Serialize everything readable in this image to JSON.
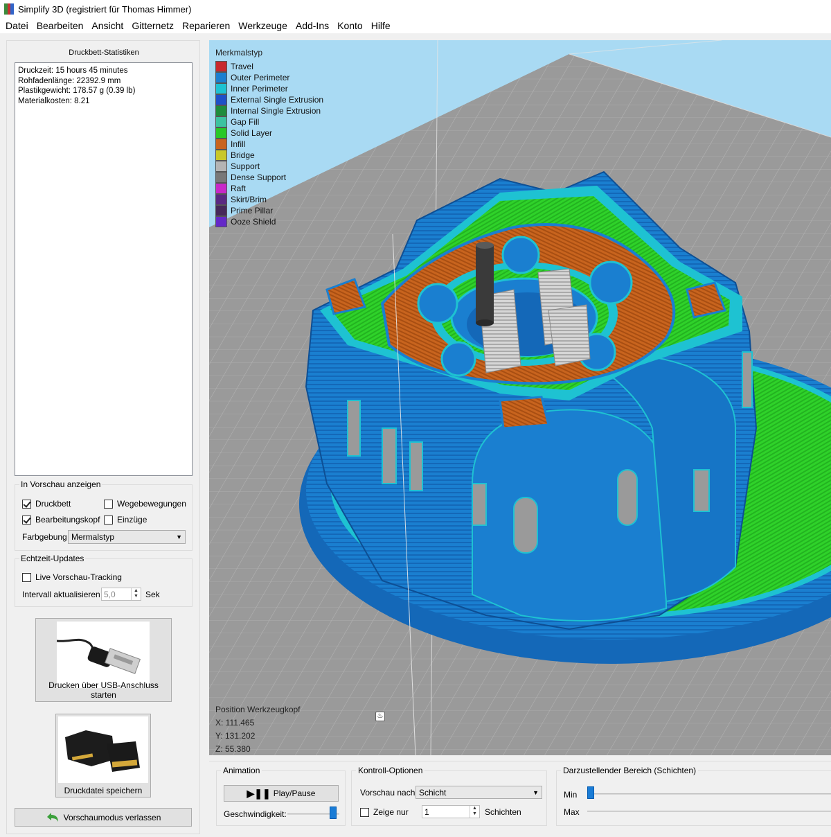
{
  "window": {
    "title": "Simplify 3D (registriert für Thomas Himmer)"
  },
  "menu": [
    "Datei",
    "Bearbeiten",
    "Ansicht",
    "Gitternetz",
    "Reparieren",
    "Werkzeuge",
    "Add-Ins",
    "Konto",
    "Hilfe"
  ],
  "stats": {
    "title": "Druckbett-Statistiken",
    "lines": [
      "Druckzeit: 15 hours 45 minutes",
      "Rohfadenlänge: 22392.9 mm",
      "Plastikgewicht: 178.57 g (0.39 lb)",
      "Materialkosten: 8.21"
    ]
  },
  "preview": {
    "title": "In Vorschau anzeigen",
    "druckbett": {
      "label": "Druckbett",
      "checked": true
    },
    "wegebewegungen": {
      "label": "Wegebewegungen",
      "checked": false
    },
    "bearbeitungskopf": {
      "label": "Bearbeitungskopf",
      "checked": true
    },
    "einzuege": {
      "label": "Einzüge",
      "checked": false
    },
    "farbgebung_label": "Farbgebung",
    "farbgebung_value": "Mermalstyp"
  },
  "realtime": {
    "title": "Echtzeit-Updates",
    "live_label": "Live Vorschau-Tracking",
    "live_checked": false,
    "interval_label": "Intervall aktualisieren",
    "interval_value": "5,0",
    "interval_unit": "Sek"
  },
  "buttons": {
    "usb_label": "Drucken über USB-Anschluss starten",
    "save_label": "Druckdatei speichern",
    "leave_label": "Vorschaumodus verlassen"
  },
  "legend": {
    "title": "Merkmalstyp",
    "items": [
      {
        "label": "Travel",
        "color": "#c8282d"
      },
      {
        "label": "Outer Perimeter",
        "color": "#1a7fd0"
      },
      {
        "label": "Inner Perimeter",
        "color": "#1ec2d2"
      },
      {
        "label": "External Single Extrusion",
        "color": "#1e50c8"
      },
      {
        "label": "Internal Single Extrusion",
        "color": "#1e8c3c"
      },
      {
        "label": "Gap Fill",
        "color": "#3cc3a0"
      },
      {
        "label": "Solid Layer",
        "color": "#28c828"
      },
      {
        "label": "Infill",
        "color": "#c8641e"
      },
      {
        "label": "Bridge",
        "color": "#c8c828"
      },
      {
        "label": "Support",
        "color": "#b4b4b4"
      },
      {
        "label": "Dense Support",
        "color": "#787878"
      },
      {
        "label": "Raft",
        "color": "#c828c8"
      },
      {
        "label": "Skirt/Brim",
        "color": "#5a2882"
      },
      {
        "label": "Prime Pillar",
        "color": "#46285a"
      },
      {
        "label": "Ooze Shield",
        "color": "#6428c8"
      }
    ]
  },
  "toolhead": {
    "title": "Position Werkzeugkopf",
    "x": "X: 111.465",
    "y": "Y: 131.202",
    "z": "Z: 55.380"
  },
  "animation": {
    "title": "Animation",
    "play_label": "Play/Pause",
    "speed_label": "Geschwindigkeit:",
    "speed_level": 0.95
  },
  "control": {
    "title": "Kontroll-Optionen",
    "preview_by_label": "Vorschau nach",
    "preview_by_value": "Schicht",
    "show_only_label": "Zeige nur",
    "show_only_checked": false,
    "layers_value": "1",
    "layers_label": "Schichten"
  },
  "range": {
    "title": "Darzustellender Bereich (Schichten)",
    "min_label": "Min",
    "max_label": "Max"
  }
}
